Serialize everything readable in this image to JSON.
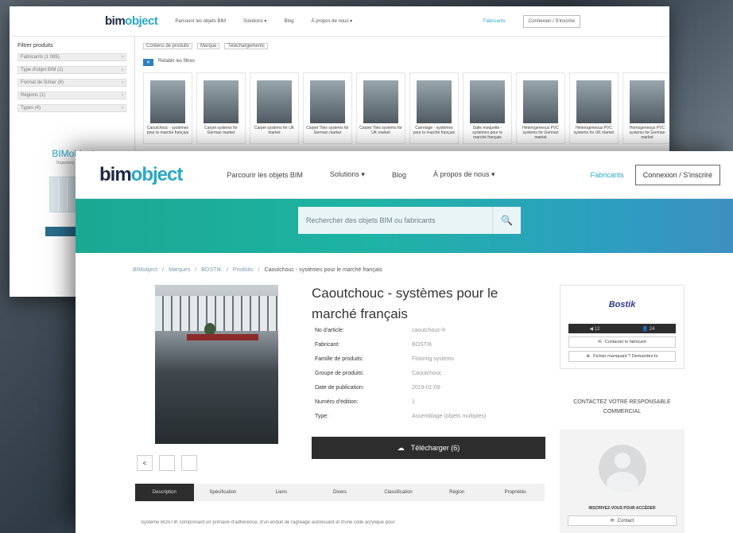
{
  "back": {
    "brand": {
      "a": "bim",
      "b": "object"
    },
    "nav": [
      "Parcourir les objets BIM",
      "Solutions ▾",
      "Blog",
      "À propos de nous ▾"
    ],
    "fabricants": "Fabricants",
    "connexion": "Connexion / S'inscrire",
    "filter_title": "Filtrer produits",
    "filters": [
      "Fabricants (1 085)",
      "Type d'objet BIM (1)",
      "Format de fichier (8)",
      "Régions (1)",
      "Types (4)"
    ],
    "promo_title": "BIMobject",
    "promo_sub": "Organisez & suivez",
    "tools": [
      "Contenu de produits",
      "Marque",
      "Téléchargements"
    ],
    "reset": "Rétablir les filtres",
    "products": [
      "Caoutchouc - systèmes pour le marché français",
      "Carpet systems for German market",
      "Carpet systems for UK market",
      "Carpet Tiles systems for German market",
      "Carpet Tiles systems for UK market",
      "Carrelage - systèmes pour le marché français",
      "Dalle moquette - systèmes pour le marché français",
      "Heterogeneous PVC systems for German market",
      "Heterogeneous PVC systems for UK market",
      "Homogeneous PVC systems for German market"
    ]
  },
  "front": {
    "brand": {
      "a": "bim",
      "b": "object"
    },
    "nav": [
      "Parcourir les objets BIM",
      "Solutions ▾",
      "Blog",
      "À propos de nous ▾"
    ],
    "fabricants": "Fabricants",
    "connexion": "Connexion / S'inscrire",
    "search_placeholder": "Rechercher des objets BIM ou fabricants",
    "search_icon": "🔍",
    "breadcrumb": [
      "BIMobject",
      "Marques",
      "BOSTIK",
      "Produits",
      "Caoutchouc - systèmes pour le marché français"
    ],
    "title": "Caoutchouc - systèmes pour le marché français",
    "attributes": [
      {
        "k": "No d'article:",
        "v": "caoutchouc-fr"
      },
      {
        "k": "Fabricant:",
        "v": "BOSTIK"
      },
      {
        "k": "Famille de produits:",
        "v": "Flooring systems"
      },
      {
        "k": "Groupe de produits:",
        "v": "Caoutchouc"
      },
      {
        "k": "Date de publication:",
        "v": "2019-01-09"
      },
      {
        "k": "Numéro d'édition:",
        "v": "1"
      },
      {
        "k": "Type:",
        "v": "Assemblage (objets multiples)"
      }
    ],
    "download": "Télécharger (6)",
    "share": [
      "<",
      "",
      ""
    ],
    "tabs": [
      "Description",
      "Spécification",
      "Liens",
      "Divers",
      "Classification",
      "Région",
      "Propriétés"
    ],
    "description": "Système BOSTIK comprenant un primaire d'adhérence, d'un enduit de ragréage autolissant et d'une colle acrylique pour",
    "manufacturer": {
      "logo": "Bostik",
      "stat1": "◀ 12",
      "stat2": "👤 24",
      "contact_btn": "Contacter le fabricant",
      "catalog_btn": "Fichier manquant ? Demandez-le"
    },
    "contact_title": "CONTACTEZ VOTRE RESPONSABLE COMMERCIAL",
    "rep_text": "INSCRIVEZ-VOUS POUR ACCÉDER",
    "rep_contact": "Contact"
  }
}
